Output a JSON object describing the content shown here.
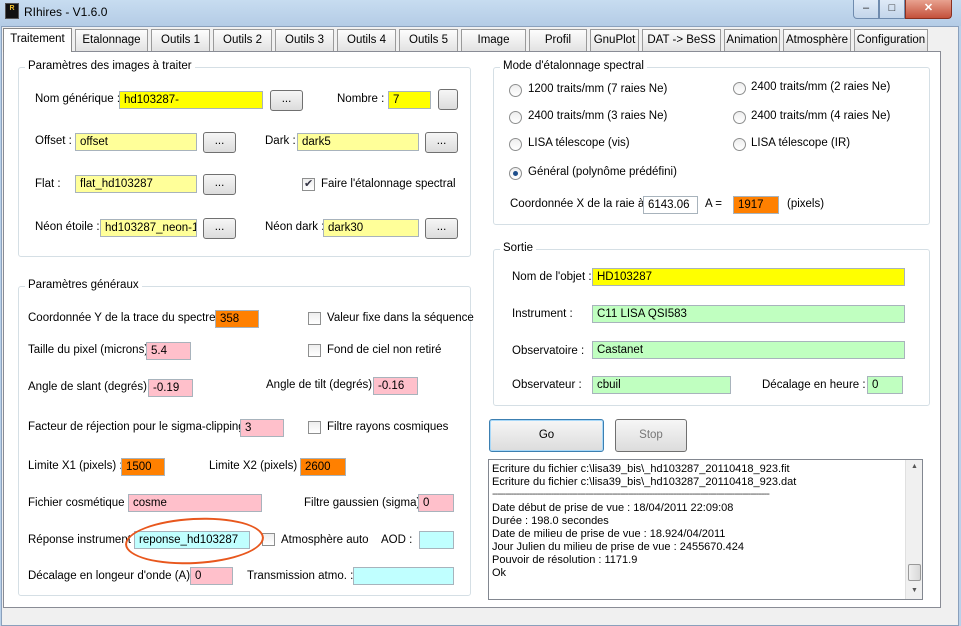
{
  "window": {
    "title": "RIhires - V1.6.0",
    "icon_text": "R",
    "minimize": "–",
    "maximize": "□",
    "close": "✕"
  },
  "tabs": [
    "Traitement",
    "Etalonnage",
    "Outils 1",
    "Outils 2",
    "Outils 3",
    "Outils 4",
    "Outils 5",
    "Image",
    "Profil",
    "GnuPlot",
    "DAT -> BeSS",
    "Animation",
    "Atmosphère",
    "Configuration"
  ],
  "images": {
    "group_title": "Paramètres des images à traiter",
    "nom_label": "Nom générique :",
    "nom_value": "hd103287-",
    "nombre_label": "Nombre :",
    "nombre_value": "7",
    "offset_label": "Offset :",
    "offset_value": "offset",
    "dark_label": "Dark :",
    "dark_value": "dark5",
    "flat_label": "Flat :",
    "flat_value": "flat_hd103287",
    "etal_label": "Faire l'étalonnage spectral",
    "neon_label": "Néon étoile :",
    "neon_value": "hd103287_neon-1",
    "neondark_label": "Néon dark :",
    "neondark_value": "dark30",
    "browse": "..."
  },
  "general": {
    "group_title": "Paramètres généraux",
    "coordy_label": "Coordonnée Y de la trace du spectre :",
    "coordy_value": "358",
    "valfixe_label": "Valeur fixe dans la séquence",
    "pixel_label": "Taille du pixel (microns) :",
    "pixel_value": "5.4",
    "fond_label": "Fond de ciel non retiré",
    "slant_label": "Angle de slant (degrés) :",
    "slant_value": "-0.19",
    "tilt_label": "Angle de tilt (degrés) :",
    "tilt_value": "-0.16",
    "sigma_label": "Facteur de réjection pour le sigma-clipping :",
    "sigma_value": "3",
    "cosmic_label": "Filtre rayons cosmiques",
    "x1_label": "Limite X1 (pixels) :",
    "x1_value": "1500",
    "x2_label": "Limite X2 (pixels) :",
    "x2_value": "2600",
    "cosm_label": "Fichier cosmétique :",
    "cosm_value": "cosme",
    "gauss_label": "Filtre gaussien (sigma) :",
    "gauss_value": "0",
    "reponse_label": "Réponse instrument :",
    "reponse_value": "reponse_hd103287",
    "atmo_label": "Atmosphère auto",
    "aod_label": "AOD :",
    "aod_value": "",
    "decal_label": "Décalage en longeur d'onde (A) :",
    "decal_value": "0",
    "trans_label": "Transmission atmo. :",
    "trans_value": ""
  },
  "mode": {
    "group_title": "Mode d'étalonnage spectral",
    "options": [
      "1200 traits/mm (7 raies Ne)",
      "2400 traits/mm (2 raies Ne)",
      "2400 traits/mm (3 raies Ne)",
      "2400 traits/mm (4 raies Ne)",
      "LISA télescope (vis)",
      "LISA télescope (IR)",
      "Général (polynôme prédéfini)"
    ],
    "selected": "Général (polynôme prédéfini)",
    "coordx_label": "Coordonnée X de la raie à",
    "coordx_value": "6143.06",
    "a_label": "A =",
    "a_value": "1917",
    "pixels_label": "(pixels)"
  },
  "sortie": {
    "group_title": "Sortie",
    "objet_label": "Nom de l'objet :",
    "objet_value": "HD103287",
    "instr_label": "Instrument :",
    "instr_value": "C11 LISA QSI583",
    "obs_label": "Observatoire :",
    "obs_value": "Castanet",
    "observ_label": "Observateur :",
    "observ_value": "cbuil",
    "decal_label": "Décalage en heure :",
    "decal_value": "0"
  },
  "actions": {
    "go": "Go",
    "stop": "Stop"
  },
  "log": [
    "Ecriture du fichier c:\\lisa39_bis\\_hd103287_20110418_923.fit",
    "Ecriture du fichier c:\\lisa39_bis\\_hd103287_20110418_923.dat",
    "--------------------------------------------------------------------------------------------------------",
    "Date début de prise de vue : 18/04/2011 22:09:08",
    "Durée : 198.0 secondes",
    "Date de milieu de prise de vue : 18.924/04/2011",
    "Jour Julien du milieu de prise de vue : 2455670.424",
    "Pouvoir de résolution : 1171.9",
    "Ok"
  ],
  "colors": {
    "yellow": "#ffff00",
    "light_yellow": "#ffff99",
    "orange": "#ff8000",
    "pink": "#ffc0cb",
    "green": "#c0ffc0",
    "cyan": "#c0ffff",
    "annotation": "#e8571d"
  }
}
